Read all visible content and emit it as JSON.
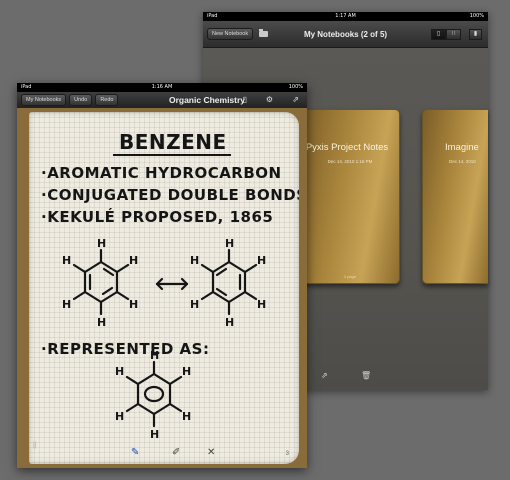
{
  "back_ipad": {
    "status": {
      "carrier": "iPad",
      "time": "1:17 AM",
      "battery": "100%"
    },
    "nav": {
      "new_notebook_label": "New Notebook",
      "title": "My Notebooks (2 of 5)"
    },
    "notebooks": [
      {
        "title": "Pyxis Project Notes",
        "date": "Dec 14, 2010 1:16 PM",
        "pages": "1 page"
      },
      {
        "title": "Imagine",
        "date": "Dec 14, 2010",
        "pages": ""
      }
    ]
  },
  "front_ipad": {
    "status": {
      "carrier": "iPad",
      "time": "1:16 AM",
      "battery": "100%"
    },
    "nav": {
      "back_label": "My Notebooks",
      "undo_label": "Undo",
      "redo_label": "Redo",
      "title": "Organic Chemistry"
    },
    "note": {
      "heading": "BENZENE",
      "bullets": [
        "·AROMATIC HYDROCARBON",
        "·CONJUGATED DOUBLE BONDS",
        "·KEKULÉ PROPOSED, 1865"
      ],
      "represented": "·REPRESENTED AS:",
      "h": "H"
    },
    "toolbar": {
      "page_number": "3"
    }
  }
}
